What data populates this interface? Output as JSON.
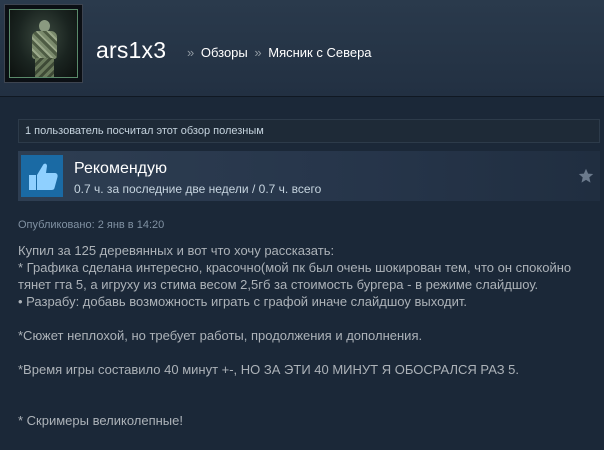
{
  "header": {
    "username": "ars1x3",
    "breadcrumb_sep": "»",
    "breadcrumbs": [
      "Обзоры",
      "Мясник с Севера"
    ]
  },
  "helpful": {
    "text": "1 пользователь посчитал этот обзор полезным"
  },
  "vote": {
    "title": "Рекомендую",
    "hours": "0.7 ч. за последние две недели / 0.7 ч. всего",
    "thumb_color": "#1a6aa4"
  },
  "posted": {
    "text": "Опубликовано: 2 янв в 14:20"
  },
  "review": {
    "lines": [
      "Купил за 125 деревянных и вот что хочу рассказать:",
      "* Графика сделана интересно, красочно(мой пк был очень шокирован тем, что он спокойно",
      "тянет гта 5, а игруху из стима весом 2,5гб за стоимость бургера - в режиме слайдшоу.",
      "• Разрабу: добавь возможность играть с графой иначе слайдшоу выходит.",
      "*Сюжет неплохой, но требует работы, продолжения и дополнения.",
      "*Время игры составило 40 минут +-, НО ЗА ЭТИ 40 МИНУТ Я ОБОСРАЛСЯ РАЗ 5.",
      "* Скримеры великолепные!"
    ]
  }
}
